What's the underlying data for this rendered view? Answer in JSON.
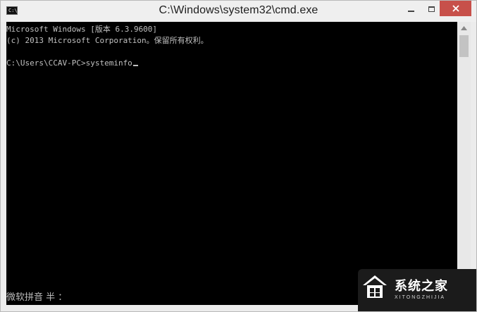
{
  "window": {
    "title": "C:\\Windows\\system32\\cmd.exe",
    "icon_label": "C:\\_"
  },
  "console": {
    "lines": [
      "Microsoft Windows [版本 6.3.9600]",
      "(c) 2013 Microsoft Corporation。保留所有权利。",
      "",
      "C:\\Users\\CCAV-PC>systeminfo"
    ],
    "ime_status": "微软拼音 半 ："
  },
  "watermark": {
    "text": "系统之家",
    "subtext": "XITONGZHIJIA"
  }
}
